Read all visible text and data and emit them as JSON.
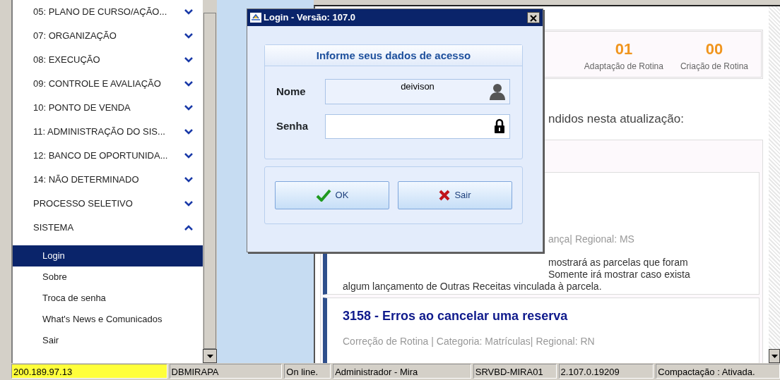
{
  "sidebar": {
    "items": [
      {
        "label": "05: PLANO DE CURSO/AÇÃO...",
        "expanded": false
      },
      {
        "label": "07: ORGANIZAÇÃO",
        "expanded": false
      },
      {
        "label": "08: EXECUÇÃO",
        "expanded": false
      },
      {
        "label": "09: CONTROLE E AVALIAÇÃO",
        "expanded": false
      },
      {
        "label": "10: PONTO DE VENDA",
        "expanded": false
      },
      {
        "label": "11: ADMINISTRAÇÃO DO SIS...",
        "expanded": false
      },
      {
        "label": "12: BANCO DE OPORTUNIDA...",
        "expanded": false
      },
      {
        "label": "14: NÃO DETERMINADO",
        "expanded": false
      },
      {
        "label": "PROCESSO SELETIVO",
        "expanded": false
      },
      {
        "label": "SISTEMA",
        "expanded": true,
        "children": [
          {
            "label": "Login",
            "selected": true
          },
          {
            "label": "Sobre",
            "selected": false
          },
          {
            "label": "Troca de senha",
            "selected": false
          },
          {
            "label": "What's News e Comunicados",
            "selected": false
          },
          {
            "label": "Sair",
            "selected": false
          }
        ]
      }
    ]
  },
  "content": {
    "summary": [
      {
        "count": "01",
        "label": "Adaptação de Rotina"
      },
      {
        "count": "00",
        "label": "Criação de Rotina"
      }
    ],
    "intro": "ndidos nesta atualização:",
    "cards": [
      {
        "meta": "ança| Regional: MS",
        "line_tails": [
          "mostrará as parcelas que foram",
          "Somente irá mostrar caso exista"
        ],
        "lines": [
          "algum lançamento de Outras Receitas vinculada à parcela."
        ]
      },
      {
        "title": "3158 - Erros ao cancelar uma reserva",
        "meta": "Correção de Rotina | Categoria: Matrículas| Regional: RN"
      }
    ]
  },
  "dialog": {
    "title": "Login - Versão: 107.0",
    "heading": "Informe seus dados de acesso",
    "fields": [
      {
        "kind": "user",
        "label": "Nome",
        "value": "deivison"
      },
      {
        "kind": "password",
        "label": "Senha"
      }
    ],
    "buttons": [
      {
        "kind": "ok",
        "label": "OK"
      },
      {
        "kind": "cancel",
        "label": "Sair"
      }
    ]
  },
  "status_bar": [
    {
      "text": "200.189.97.13",
      "highlighted": true
    },
    {
      "text": "DBMIRAPA",
      "highlighted": false
    },
    {
      "text": "On line.",
      "highlighted": false
    },
    {
      "text": "Administrador - Mira",
      "highlighted": false
    },
    {
      "text": "SRVBD-MIRA01",
      "highlighted": false
    },
    {
      "text": "2.107.0.19209",
      "highlighted": false
    },
    {
      "text": "Compactação : Ativada.",
      "highlighted": false
    }
  ]
}
